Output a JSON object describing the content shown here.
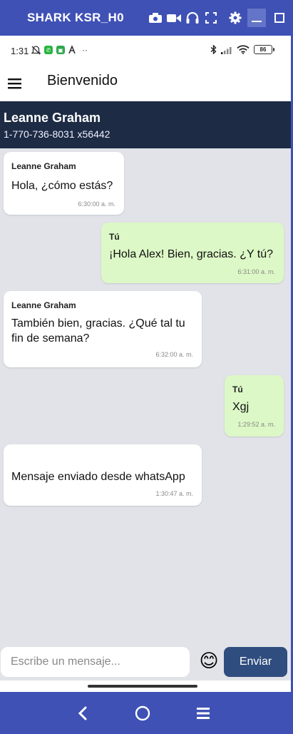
{
  "emulator": {
    "title": "SHARK KSR_H0",
    "icons": [
      "camera-icon",
      "video-icon",
      "headphones-icon",
      "fullscreen-icon",
      "gear-icon",
      "minimize-icon",
      "maximize-icon"
    ]
  },
  "status_bar": {
    "time": "1:31",
    "battery": "86",
    "more": "··",
    "left_icons": [
      "mute-alarm-icon",
      "whatsapp-icon",
      "app-icon",
      "a-icon"
    ],
    "right_icons": [
      "bluetooth-icon",
      "signal-icon",
      "wifi-icon",
      "battery-icon"
    ]
  },
  "app_bar": {
    "title": "Bienvenido"
  },
  "contact": {
    "name": "Leanne Graham",
    "phone": "1-770-736-8031 x56442"
  },
  "messages": [
    {
      "direction": "in",
      "sender": "Leanne Graham",
      "text": "Hola, ¿cómo estás?",
      "time": "6:30:00 a. m."
    },
    {
      "direction": "out",
      "sender": "Tú",
      "text": "¡Hola Alex! Bien, gracias. ¿Y tú?",
      "time": "6:31:00 a. m."
    },
    {
      "direction": "in",
      "sender": "Leanne Graham",
      "text": "También bien, gracias. ¿Qué tal tu fin de semana?",
      "time": "6:32:00 a. m."
    },
    {
      "direction": "out",
      "sender": "Tú",
      "text": "Xgj",
      "time": "1:29:52 a. m."
    },
    {
      "direction": "in",
      "sender": "",
      "text": "Mensaje enviado desde whatsApp",
      "time": "1:30:47 a. m."
    }
  ],
  "composer": {
    "placeholder": "Escribe un mensaje...",
    "emoji": "😊",
    "send_label": "Enviar"
  },
  "colors": {
    "emulator_bar": "#3f51b5",
    "contact_header": "#1d2b44",
    "incoming_bubble": "#ffffff",
    "outgoing_bubble": "#dcf8c6",
    "chat_background": "#e1e3e8",
    "send_button": "#2f4d7e"
  }
}
